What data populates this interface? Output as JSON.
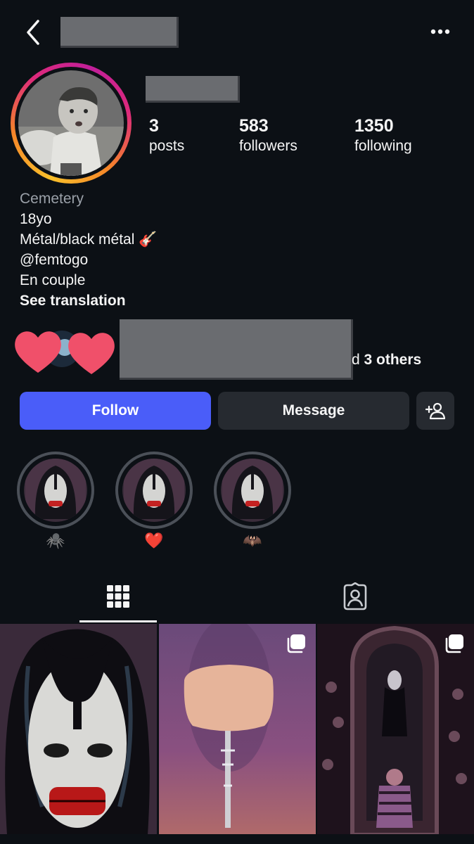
{
  "header": {
    "back_icon": "chevron-left-icon",
    "more_icon": "more-horizontal-icon"
  },
  "stats": {
    "posts": {
      "value": "3",
      "label": "posts"
    },
    "followers": {
      "value": "583",
      "label": "followers"
    },
    "following": {
      "value": "1350",
      "label": "following"
    }
  },
  "bio": {
    "category": "Cemetery",
    "lines": [
      "18yo",
      "Métal/black métal 🎸",
      "@femtogo",
      "En couple"
    ],
    "see_translation": "See translation"
  },
  "mutual": {
    "prefix": "d ",
    "others": "3 others"
  },
  "actions": {
    "follow": "Follow",
    "message": "Message",
    "add_user_icon": "add-person-icon"
  },
  "highlights": [
    {
      "emoji": "🕷️"
    },
    {
      "emoji": "❤️"
    },
    {
      "emoji": "🦇"
    }
  ],
  "tabs": [
    {
      "icon": "grid-icon",
      "selected": true
    },
    {
      "icon": "tagged-icon",
      "selected": false
    }
  ],
  "colors": {
    "background": "#0c1015",
    "follow_blue": "#4a5df9",
    "button_gray": "#262a30",
    "category_gray": "#9aa0a8"
  }
}
